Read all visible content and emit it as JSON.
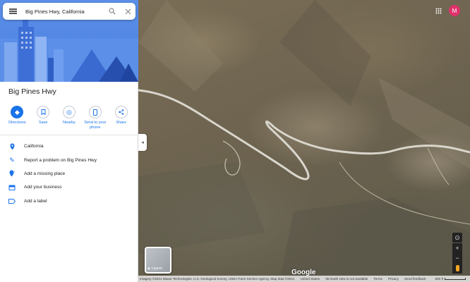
{
  "search": {
    "value": "Big Pines Hwy, California"
  },
  "place": {
    "title": "Big Pines Hwy"
  },
  "actions": [
    {
      "label": "Directions",
      "icon": "directions-icon"
    },
    {
      "label": "Save",
      "icon": "bookmark-icon"
    },
    {
      "label": "Nearby",
      "icon": "nearby-icon"
    },
    {
      "label": "Send to your phone",
      "icon": "phone-icon"
    },
    {
      "label": "Share",
      "icon": "share-icon"
    }
  ],
  "info": [
    {
      "label": "California",
      "icon": "pin-icon"
    },
    {
      "label": "Report a problem on Big Pines Hwy",
      "icon": "pencil-icon"
    },
    {
      "label": "Add a missing place",
      "icon": "add-place-icon"
    },
    {
      "label": "Add your business",
      "icon": "store-icon"
    },
    {
      "label": "Add a label",
      "icon": "label-icon"
    }
  ],
  "user": {
    "initial": "M"
  },
  "layers": {
    "label": "Layers"
  },
  "logo": "Google",
  "attribution": {
    "imagery": "Imagery ©2021 Maxar Technologies, U.S. Geological Survey, USDA Farm Service Agency, Map data ©2021",
    "country": "United States",
    "earth": "3D Earth view is not available",
    "terms": "Terms",
    "privacy": "Privacy",
    "feedback": "Send feedback",
    "scale": "500 ft"
  },
  "colors": {
    "accent": "#1a73e8",
    "avatar": "#e0316c",
    "hero": "#4a7fe0"
  }
}
